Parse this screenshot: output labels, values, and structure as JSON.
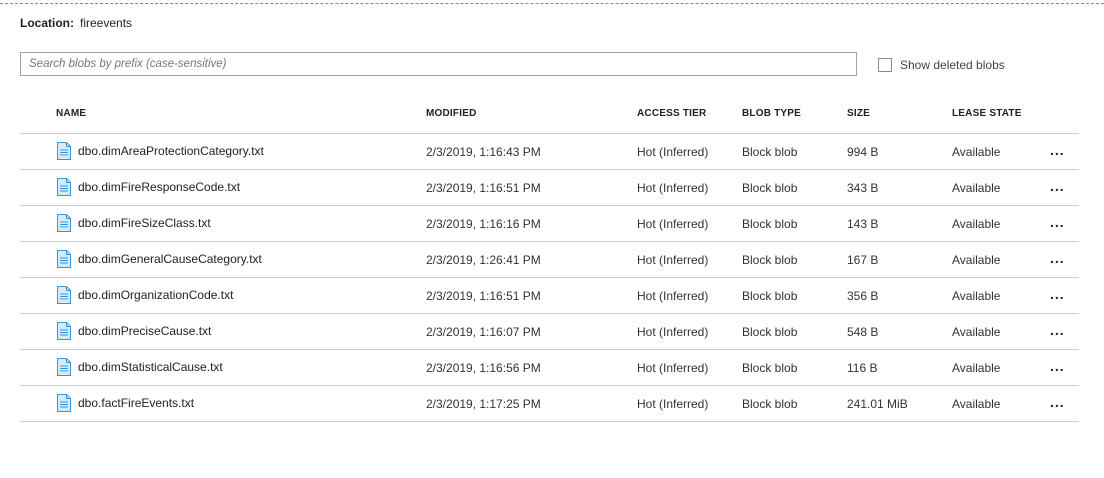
{
  "location": {
    "label": "Location:",
    "value": "fireevents"
  },
  "search": {
    "placeholder": "Search blobs by prefix (case-sensitive)",
    "value": ""
  },
  "show_deleted": {
    "label": "Show deleted blobs",
    "checked": false
  },
  "table": {
    "headers": {
      "name": "NAME",
      "modified": "MODIFIED",
      "access_tier": "ACCESS TIER",
      "blob_type": "BLOB TYPE",
      "size": "SIZE",
      "lease_state": "LEASE STATE"
    },
    "rows": [
      {
        "name": "dbo.dimAreaProtectionCategory.txt",
        "modified": "2/3/2019, 1:16:43 PM",
        "access_tier": "Hot (Inferred)",
        "blob_type": "Block blob",
        "size": "994 B",
        "lease_state": "Available",
        "more": "..."
      },
      {
        "name": "dbo.dimFireResponseCode.txt",
        "modified": "2/3/2019, 1:16:51 PM",
        "access_tier": "Hot (Inferred)",
        "blob_type": "Block blob",
        "size": "343 B",
        "lease_state": "Available",
        "more": "..."
      },
      {
        "name": "dbo.dimFireSizeClass.txt",
        "modified": "2/3/2019, 1:16:16 PM",
        "access_tier": "Hot (Inferred)",
        "blob_type": "Block blob",
        "size": "143 B",
        "lease_state": "Available",
        "more": "..."
      },
      {
        "name": "dbo.dimGeneralCauseCategory.txt",
        "modified": "2/3/2019, 1:26:41 PM",
        "access_tier": "Hot (Inferred)",
        "blob_type": "Block blob",
        "size": "167 B",
        "lease_state": "Available",
        "more": "..."
      },
      {
        "name": "dbo.dimOrganizationCode.txt",
        "modified": "2/3/2019, 1:16:51 PM",
        "access_tier": "Hot (Inferred)",
        "blob_type": "Block blob",
        "size": "356 B",
        "lease_state": "Available",
        "more": "..."
      },
      {
        "name": "dbo.dimPreciseCause.txt",
        "modified": "2/3/2019, 1:16:07 PM",
        "access_tier": "Hot (Inferred)",
        "blob_type": "Block blob",
        "size": "548 B",
        "lease_state": "Available",
        "more": "..."
      },
      {
        "name": "dbo.dimStatisticalCause.txt",
        "modified": "2/3/2019, 1:16:56 PM",
        "access_tier": "Hot (Inferred)",
        "blob_type": "Block blob",
        "size": "116 B",
        "lease_state": "Available",
        "more": "..."
      },
      {
        "name": "dbo.factFireEvents.txt",
        "modified": "2/3/2019, 1:17:25 PM",
        "access_tier": "Hot (Inferred)",
        "blob_type": "Block blob",
        "size": "241.01 MiB",
        "lease_state": "Available",
        "more": "..."
      }
    ]
  },
  "icons": {
    "file": "file-text-icon",
    "more": "more-options-icon"
  },
  "colors": {
    "accent": "#2ea3d8",
    "icon_fill": "#d6ebf8",
    "icon_stroke": "#3a96dd"
  }
}
